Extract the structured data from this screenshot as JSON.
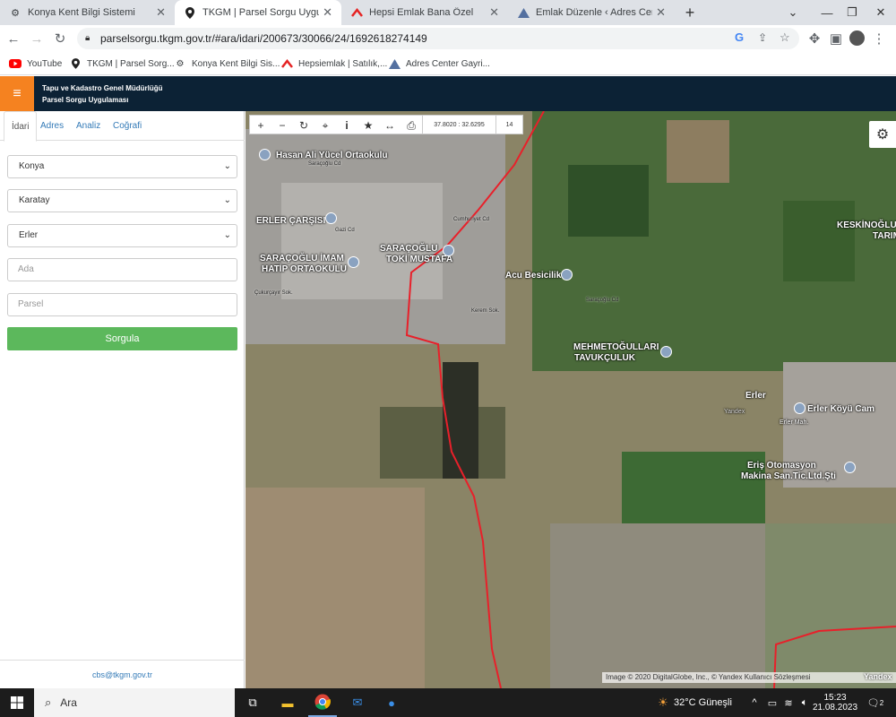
{
  "browser": {
    "tabs": [
      {
        "title": "Konya Kent Bilgi Sistemi",
        "icon": "globe-icon"
      },
      {
        "title": "TKGM | Parsel Sorgu Uygulaması",
        "icon": "location-pin-icon"
      },
      {
        "title": "Hepsi Emlak Bana Özel",
        "icon": "hepsiemlak-logo-icon"
      },
      {
        "title": "Emlak Düzenle ‹ Adres Center Ga",
        "icon": "triangle-logo-icon"
      }
    ],
    "url": "parselsorgu.tkgm.gov.tr/#ara/idari/200673/30066/24/1692618274149",
    "bookmarks": [
      "YouTube",
      "TKGM | Parsel Sorg...",
      "Konya Kent Bilgi Sis...",
      "Hepsiemlak | Satılık,...",
      "Adres Center Gayri..."
    ]
  },
  "header": {
    "line1": "Tapu ve Kadastro Genel Müdürlüğü",
    "line2": "Parsel Sorgu Uygulaması"
  },
  "sidebar": {
    "tabs": [
      "İdari",
      "Adres",
      "Analiz",
      "Coğrafi"
    ],
    "il": "Konya",
    "ilce": "Karatay",
    "mahalle": "Erler",
    "ada_placeholder": "Ada",
    "parsel_placeholder": "Parsel",
    "button": "Sorgula",
    "email": "cbs@tkgm.gov.tr"
  },
  "map": {
    "coords": "37.8020 : 32.6295",
    "zoom": "14",
    "labels": {
      "hasan": "Hasan Ali Yücel Ortaokulu",
      "erler_carsi": "ERLER ÇARŞISI",
      "saracoglu_imam": "SARAÇOĞLU İMAM",
      "hatip": "HATİP ORTAOKULU",
      "saracoglu_toki": "SARAÇOĞLU",
      "toki": "TOKİ MUSTAFA",
      "acu": "Acu Besicilik",
      "mehmet": "MEHMETOĞULLARI",
      "tavuk": "TAVUKÇULUK",
      "keskin": "KESKİNOĞLU",
      "tarim": "TARIM",
      "erler": "Erler",
      "erler_koyu": "Erler Köyü Cam",
      "eris": "Eriş Otomasyon",
      "makina": "Makina San.Tic.Ltd.Şti",
      "yandex_mid": "Yandex",
      "erler_mah": "Erler Mah."
    },
    "roads": [
      "Saraçoğlu Cd",
      "Cumhuriyet Cd",
      "Çukurçayır Sok.",
      "Gazi Cd",
      "Saraçoğlu Cd",
      "Kerem Sok."
    ],
    "attribution": "Image © 2020 DigitalGlobe, Inc., © Yandex Kullanıcı Sözleşmesi",
    "yandex": "Yandex"
  },
  "taskbar": {
    "search": "Ara",
    "weather": "32°C  Güneşli",
    "time": "15:23",
    "date": "21.08.2023",
    "notif": "2"
  }
}
